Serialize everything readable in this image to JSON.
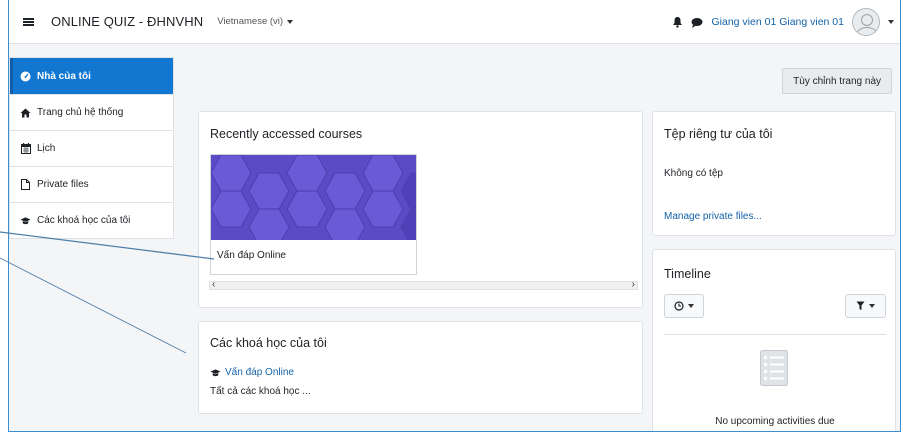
{
  "navbar": {
    "site_name": "ONLINE QUIZ - ĐHNVHN",
    "language": "Vietnamese (vi)",
    "user_name": "Giang vien 01 Giang vien 01"
  },
  "drawer": {
    "items": [
      {
        "label": "Nhà của tôi",
        "icon": "dashboard-icon"
      },
      {
        "label": "Trang chủ hệ thống",
        "icon": "home-icon"
      },
      {
        "label": "Lịch",
        "icon": "calendar-icon"
      },
      {
        "label": "Private files",
        "icon": "file-icon"
      },
      {
        "label": "Các khoá học của tôi",
        "icon": "graduation-cap-icon"
      }
    ]
  },
  "page": {
    "customize_label": "Tùy chỉnh trang này"
  },
  "recent": {
    "title": "Recently accessed courses",
    "course_name": "Vấn đáp Online",
    "scroll_left": "‹",
    "scroll_right": "›"
  },
  "mycourses": {
    "title": "Các khoá học của tôi",
    "course_link": "Vấn đáp Online",
    "all_courses": "Tất cả các khoá học ..."
  },
  "private_files": {
    "title": "Tệp riêng tư của tôi",
    "empty": "Không có tệp",
    "manage": "Manage private files..."
  },
  "timeline": {
    "title": "Timeline",
    "empty": "No upcoming activities due"
  },
  "colors": {
    "accent": "#1177d1",
    "link": "#1462a8",
    "course_image": "#5b4bc4"
  }
}
